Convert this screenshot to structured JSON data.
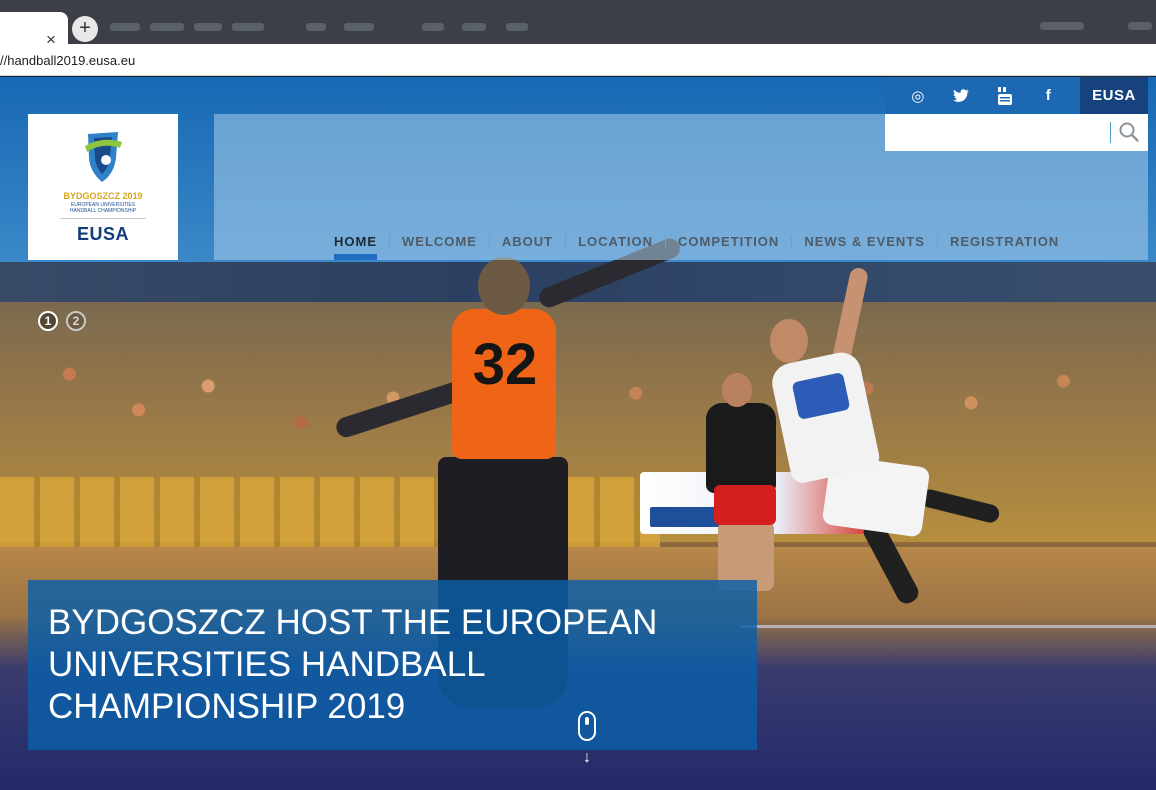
{
  "browser": {
    "close_tab_glyph": "×",
    "new_tab_glyph": "+",
    "url": "//handball2019.eusa.eu"
  },
  "social": {
    "icons": [
      "instagram-icon",
      "twitter-icon",
      "youtube-icon",
      "facebook-icon"
    ],
    "instagram_glyph": "◎",
    "twitter_glyph": "🐦",
    "youtube_glyph": "▶",
    "facebook_glyph": "f",
    "eusa_label": "EUSA"
  },
  "search": {
    "placeholder": ""
  },
  "logo": {
    "title": "BYDGOSZCZ 2019",
    "subtitle_1": "EUROPEAN UNIVERSITIES",
    "subtitle_2": "HANDBALL CHAMPIONSHIP",
    "org": "EUSA"
  },
  "nav": {
    "items": [
      {
        "label": "HOME",
        "active": true
      },
      {
        "label": "WELCOME"
      },
      {
        "label": "ABOUT"
      },
      {
        "label": "LOCATION"
      },
      {
        "label": "COMPETITION"
      },
      {
        "label": "NEWS & EVENTS"
      },
      {
        "label": "REGISTRATION"
      }
    ]
  },
  "slider": {
    "dots": [
      "1",
      "2"
    ],
    "active_index": 1
  },
  "hero": {
    "headline": "BYDGOSZCZ HOST THE EUROPEAN UNIVERSITIES HANDBALL CHAMPIONSHIP 2019",
    "jersey_number": "32",
    "scroll_arrow": "↓"
  },
  "colors": {
    "accent_blue": "#1e6dc0",
    "eusa_navy": "#16427d",
    "logo_gold": "#d7a51a"
  }
}
